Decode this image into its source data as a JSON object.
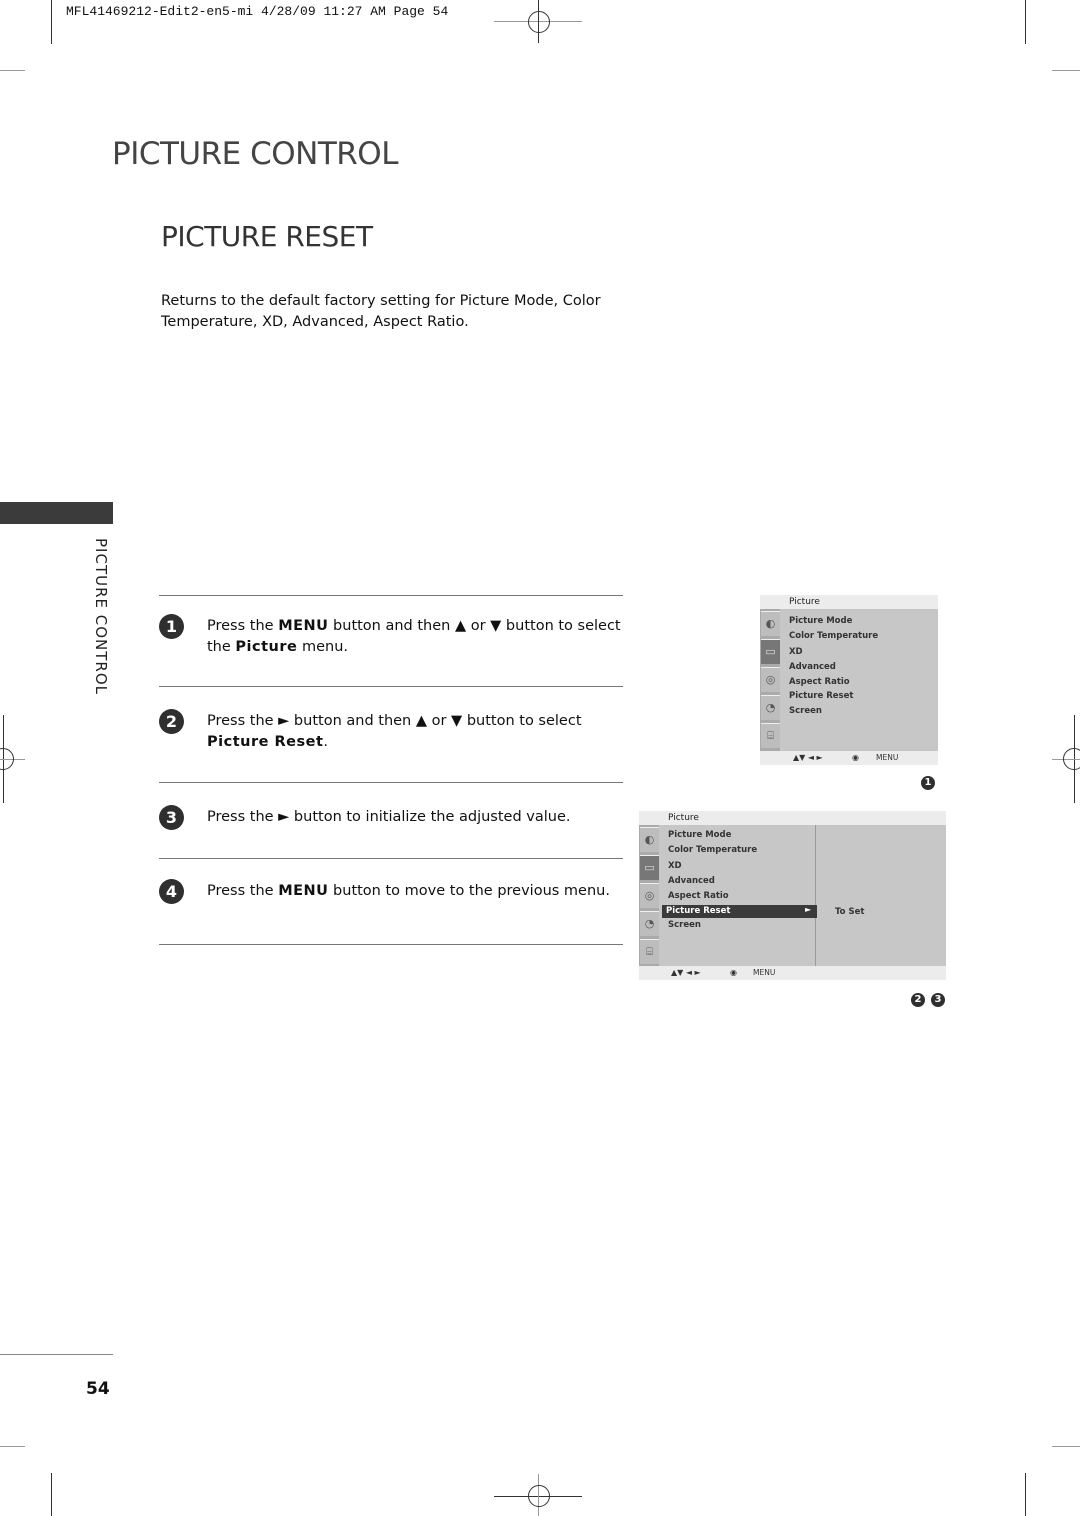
{
  "slug": "MFL41469212-Edit2-en5-mi  4/28/09 11:27 AM  Page 54",
  "section_title": "PICTURE CONTROL",
  "page_title": "PICTURE RESET",
  "intro": "Returns to the default factory setting for Picture Mode, Color Temperature, XD, Advanced, Aspect Ratio.",
  "side_tab_label": "PICTURE CONTROL",
  "steps": [
    {
      "num": "1",
      "parts": [
        "Press the ",
        "MENU",
        " button and then ▲ or ▼ button to select the ",
        "Picture",
        " menu."
      ]
    },
    {
      "num": "2",
      "parts": [
        "Press the ► button and then ▲ or ▼ button to select ",
        "Picture Reset",
        "."
      ]
    },
    {
      "num": "3",
      "parts": [
        "Press the ► button to initialize the adjusted value."
      ]
    },
    {
      "num": "4",
      "parts": [
        "Press the ",
        "MENU",
        " button to move to the previous menu."
      ]
    }
  ],
  "osd1": {
    "title": "Picture",
    "items": [
      "Picture Mode",
      "Color Temperature",
      "XD",
      "Advanced",
      "Aspect Ratio",
      "Picture Reset",
      "Screen"
    ],
    "footer": {
      "nav": "▲▼  ◄ ►",
      "ok": "◉",
      "menu": "MENU"
    },
    "badge": "1"
  },
  "osd2": {
    "title": "Picture",
    "items": [
      "Picture Mode",
      "Color Temperature",
      "XD",
      "Advanced",
      "Aspect Ratio",
      "Picture Reset",
      "Screen"
    ],
    "selected": "Picture Reset",
    "submenu_value": "To Set",
    "footer": {
      "nav": "▲▼  ◄ ►",
      "ok": "◉",
      "menu": "MENU"
    },
    "badges": [
      "2",
      "3"
    ]
  },
  "icons": [
    "picture-icon",
    "screen-icon",
    "audio-icon",
    "time-icon",
    "option-icon"
  ],
  "page_number": "54"
}
